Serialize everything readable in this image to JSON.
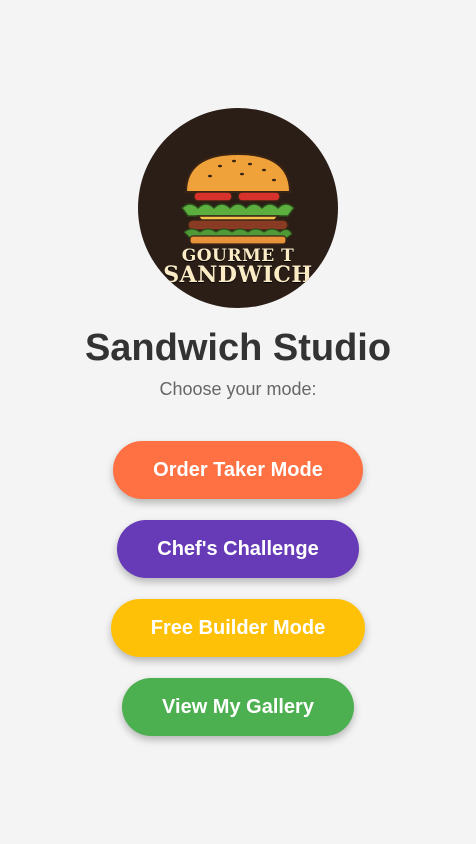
{
  "logo": {
    "line1": "GOURME T",
    "line2": "SANDWICH"
  },
  "header": {
    "title": "Sandwich Studio",
    "subtitle": "Choose your mode:"
  },
  "modes": [
    {
      "label": "Order Taker Mode",
      "color": "#ff7043"
    },
    {
      "label": "Chef's Challenge",
      "color": "#673ab7"
    },
    {
      "label": "Free Builder Mode",
      "color": "#ffc107"
    },
    {
      "label": "View My Gallery",
      "color": "#4caf50"
    }
  ],
  "colors": {
    "background": "#f4f4f4",
    "logo_background": "#2b1e17",
    "title_text": "#333333",
    "subtitle_text": "#666666"
  }
}
